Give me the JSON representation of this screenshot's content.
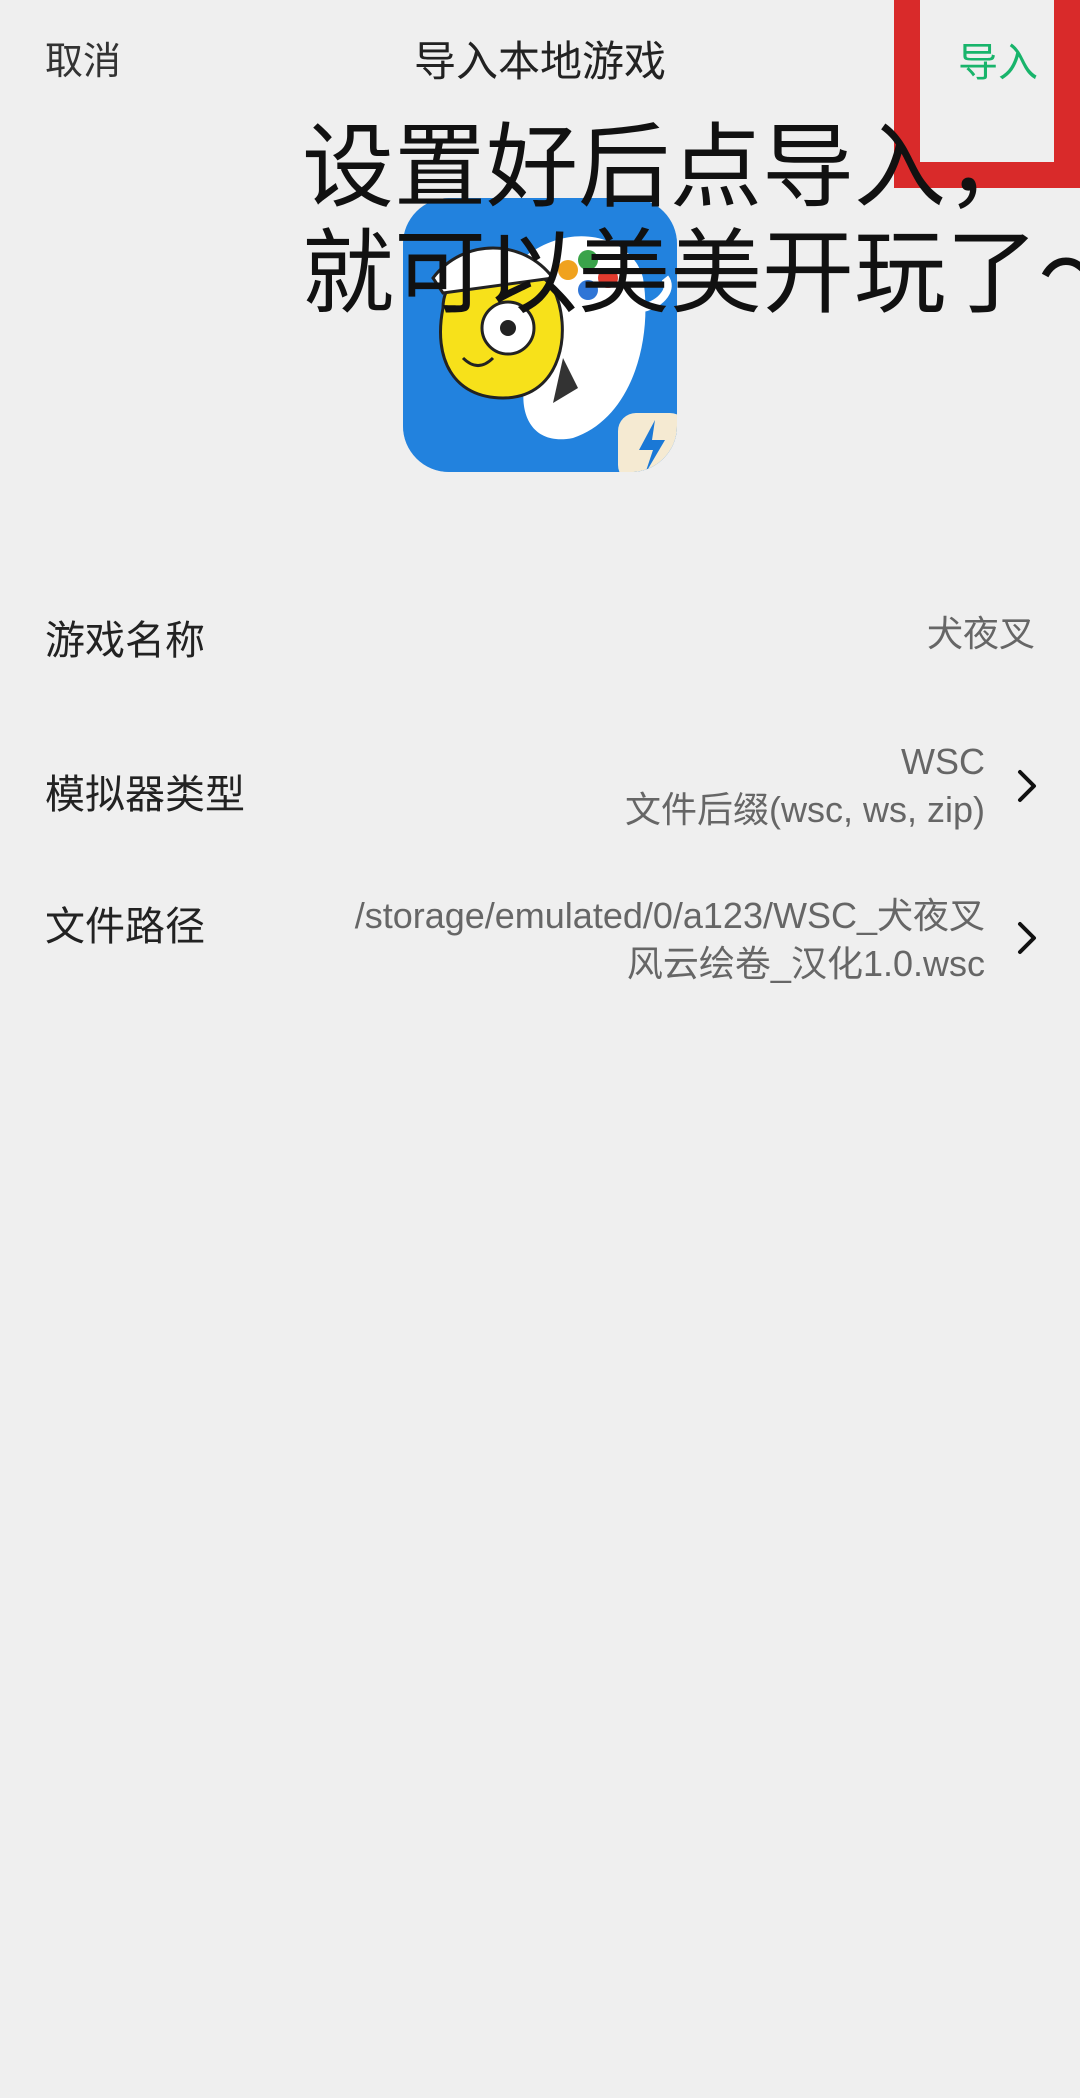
{
  "topbar": {
    "cancel_label": "取消",
    "title": "导入本地游戏",
    "import_label": "导入"
  },
  "overlay": {
    "line1": "设置好后点导入，",
    "line2": "就可以美美开玩了～"
  },
  "fields": {
    "game_name": {
      "label": "游戏名称",
      "value": "犬夜叉"
    },
    "emulator_type": {
      "label": "模拟器类型",
      "value_line1": "WSC",
      "value_line2": "文件后缀(wsc, ws, zip)"
    },
    "file_path": {
      "label": "文件路径",
      "value_line1": "/storage/emulated/0/a123/WSC_犬夜叉",
      "value_line2": "风云绘卷_汉化1.0.wsc"
    }
  },
  "colors": {
    "accent": "#18b46b",
    "highlight_box": "#d92a2a",
    "background": "#efefef"
  },
  "icons": [
    "app-logo-icon",
    "chevron-right-icon"
  ]
}
